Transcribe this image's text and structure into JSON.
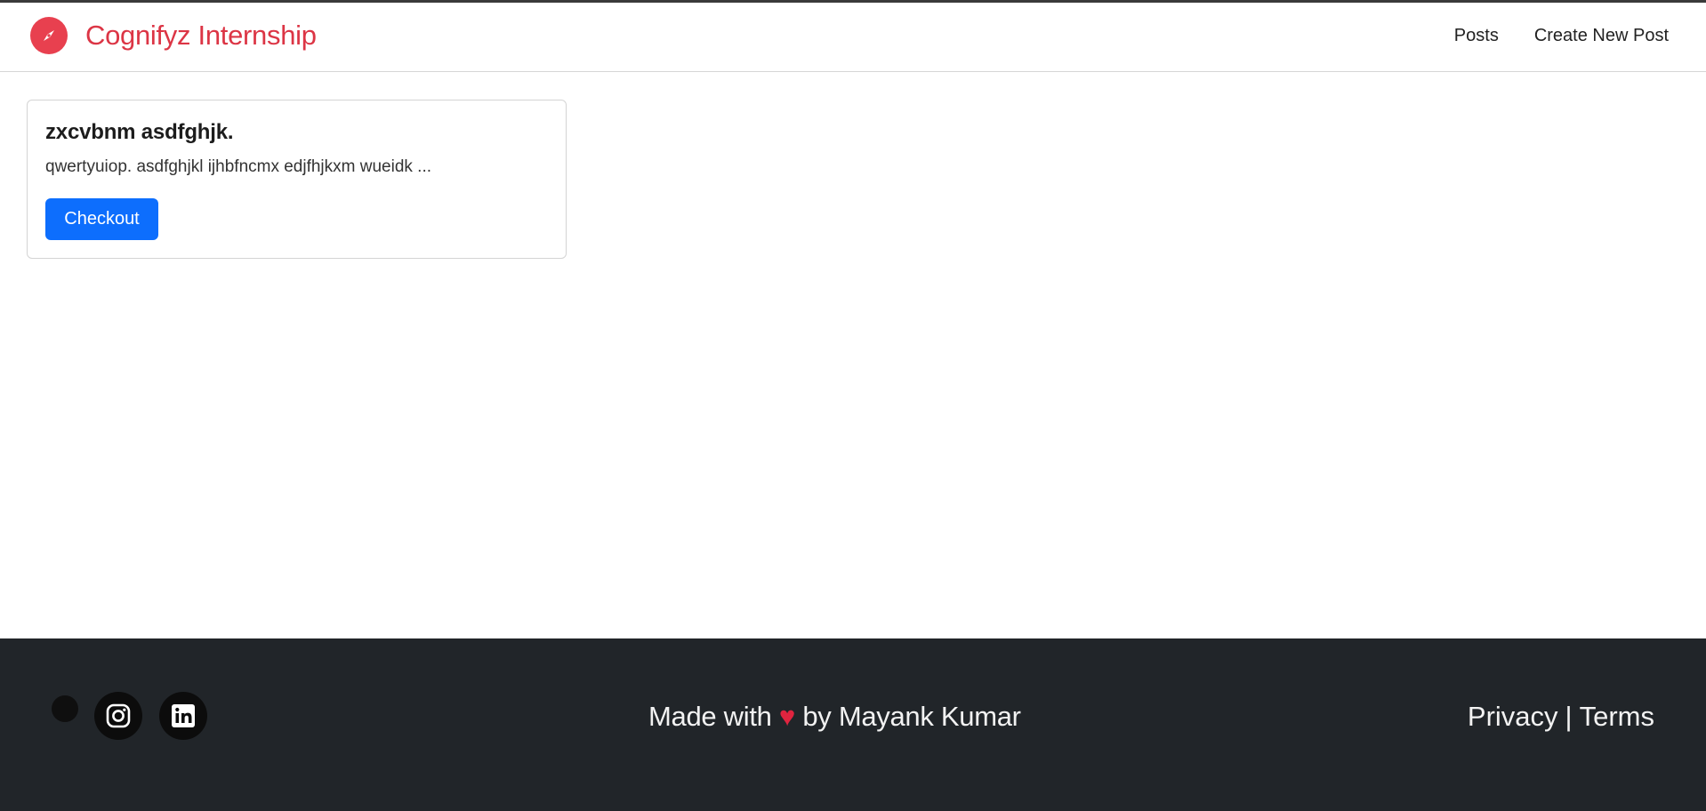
{
  "nav": {
    "brand": "Cognifyz Internship",
    "links": [
      "Posts",
      "Create New Post"
    ]
  },
  "post": {
    "title": "zxcvbnm asdfghjk.",
    "excerpt": "qwertyuiop. asdfghjkl ijhbfncmx edjfhjkxm wueidk ...",
    "button": "Checkout"
  },
  "footer": {
    "made_with": "Made with",
    "heart": "♥",
    "by": "by Mayank Kumar",
    "privacy": "Privacy",
    "separator": "|",
    "terms": "Terms",
    "social_icons": [
      "dot-icon",
      "instagram-icon",
      "linkedin-icon"
    ]
  },
  "colors": {
    "brand": "#dc3545",
    "primary_button": "#0d6efd",
    "footer_bg": "#212529",
    "heart": "#e0243f"
  }
}
